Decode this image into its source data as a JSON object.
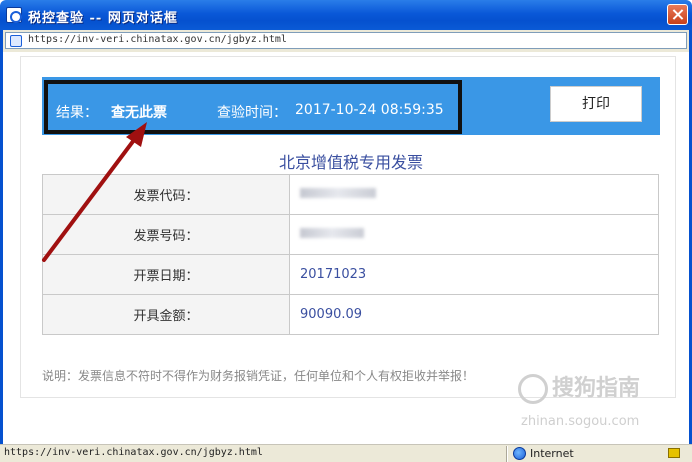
{
  "window": {
    "title": "税控查验 -- 网页对话框",
    "address_url": "https://inv-veri.chinatax.gov.cn/jgbyz.html"
  },
  "result_bar": {
    "result_label": "结果：",
    "result_value": "查无此票",
    "time_label": "查验时间：",
    "time_value": "2017-10-24 08:59:35",
    "print_label": "打印"
  },
  "invoice": {
    "title": "北京增值税专用发票",
    "rows": [
      {
        "label": "发票代码：",
        "value": "",
        "redacted": true
      },
      {
        "label": "发票号码：",
        "value": "",
        "redacted": true
      },
      {
        "label": "开票日期：",
        "value": "20171023",
        "redacted": false
      },
      {
        "label": "开具金额：",
        "value": "90090.09",
        "redacted": false
      }
    ]
  },
  "note": "说明：发票信息不符时不得作为财务报销凭证，任何单位和个人有权拒收并举报！",
  "watermark": {
    "brand": "搜狗指南",
    "domain": "zhinan.sogou.com"
  },
  "statusbar": {
    "url": "https://inv-veri.chinatax.gov.cn/jgbyz.html",
    "zone": "Internet"
  },
  "colors": {
    "titlebar_blue": "#0551cf",
    "result_bar_blue": "#3a97e6",
    "invoice_text": "#3a4fa0",
    "annotation_arrow": "#a01010"
  }
}
